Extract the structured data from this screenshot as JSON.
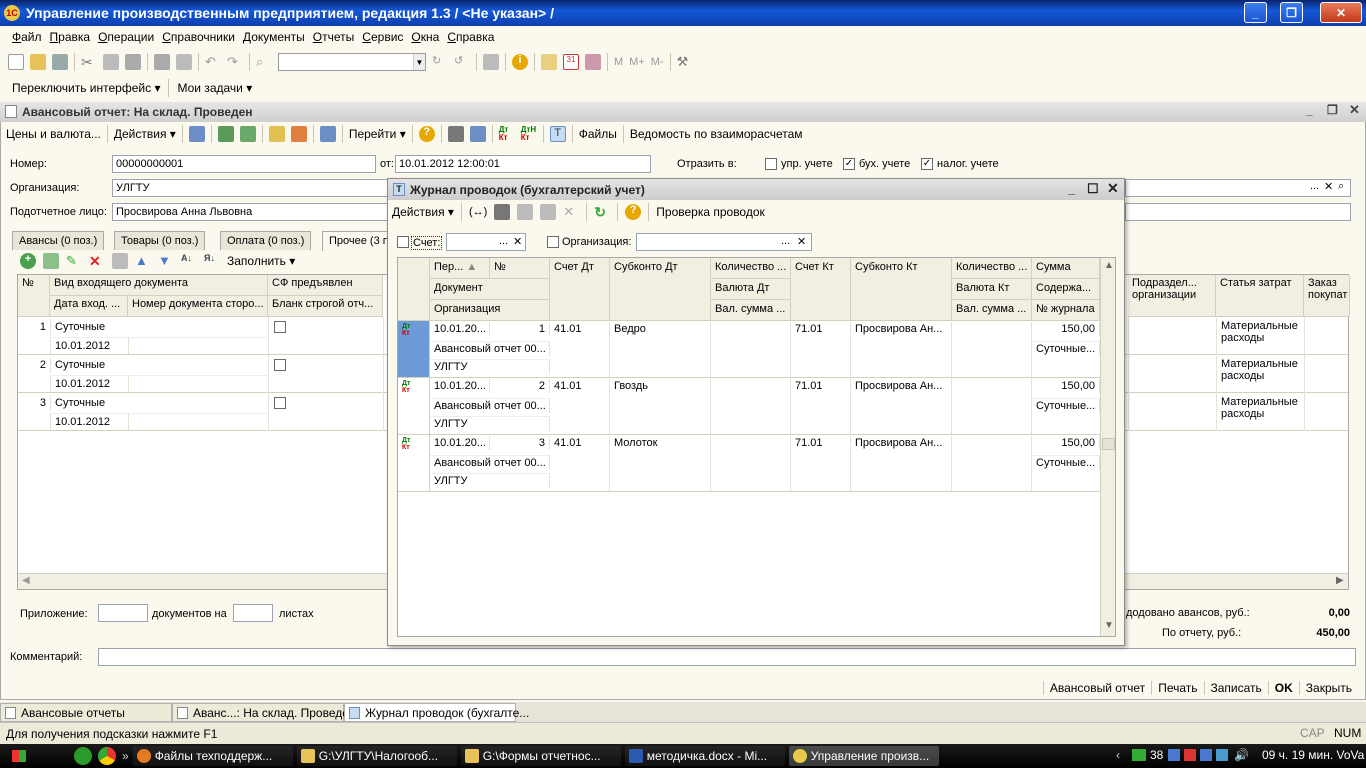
{
  "app": {
    "title": "Управление производственным предприятием, редакция 1.3 / <Не указан> /"
  },
  "menu": [
    "Файл",
    "Правка",
    "Операции",
    "Справочники",
    "Документы",
    "Отчеты",
    "Сервис",
    "Окна",
    "Справка"
  ],
  "toolbar2": {
    "switch_interface": "Переключить интерфейс",
    "my_tasks": "Мои задачи"
  },
  "doc": {
    "title": "Авансовый отчет: На склад. Проведен",
    "toolbar": {
      "prices": "Цены и валюта...",
      "actions": "Действия",
      "goto": "Перейти",
      "files": "Файлы",
      "statement": "Ведомость по взаиморасчетам"
    },
    "number_label": "Номер:",
    "number": "00000000001",
    "from_label": "от:",
    "date": "10.01.2012 12:00:01",
    "reflect_label": "Отразить в:",
    "reflect": [
      {
        "label": "упр. учете",
        "checked": false
      },
      {
        "label": "бух. учете",
        "checked": true
      },
      {
        "label": "налог. учете",
        "checked": true
      }
    ],
    "org_label": "Организация:",
    "org": "УЛГТУ",
    "person_label": "Подотчетное лицо:",
    "person": "Просвирова Анна Львовна",
    "tabs": [
      "Авансы (0 поз.)",
      "Товары (0 поз.)",
      "Оплата (0 поз.)",
      "Прочее (3 п"
    ],
    "fill_label": "Заполнить",
    "columns": {
      "num": "№",
      "doctype": "Вид входящего документа",
      "date_in": "Дата вход. ...",
      "doc_num": "Номер документа сторо...",
      "sf": "СФ предъявлен",
      "blank": "Бланк строгой отч...",
      "dept": "Подраздел... организации",
      "cost": "Статья затрат",
      "order": "Заказ покупат"
    },
    "rows": [
      {
        "n": "1",
        "type": "Суточные",
        "date": "10.01.2012",
        "cost": "Материальные расходы"
      },
      {
        "n": "2",
        "type": "Суточные",
        "date": "10.01.2012",
        "cost": "Материальные расходы"
      },
      {
        "n": "3",
        "type": "Суточные",
        "date": "10.01.2012",
        "cost": "Материальные расходы"
      }
    ],
    "attach_label": "Приложение:",
    "docs_on": "документов на",
    "sheets": "листах",
    "adv_label": "додовано авансов, руб.:",
    "adv_value": "0,00",
    "report_label": "По отчету, руб.:",
    "report_value": "450,00",
    "comment_label": "Комментарий:"
  },
  "bottom": [
    "Авансовый отчет",
    "Печать",
    "Записать",
    "OK",
    "Закрыть"
  ],
  "journal": {
    "title": "Журнал проводок (бухгалтерский учет)",
    "actions": "Действия",
    "check": "Проверка проводок",
    "filter_account": "Счет:",
    "filter_org": "Организация:",
    "headers": {
      "period": "Пер...",
      "num": "№",
      "acc_dt": "Счет Дт",
      "sub_dt": "Субконто Дт",
      "qty_dt": "Количество ...",
      "acc_kt": "Счет Кт",
      "sub_kt": "Субконто Кт",
      "qty_kt": "Количество ...",
      "sum": "Сумма",
      "document": "Документ",
      "cur_dt": "Валюта Дт",
      "cur_kt": "Валюта Кт",
      "content": "Содержа...",
      "organization": "Организация",
      "cur_sum_dt": "Вал. сумма ...",
      "cur_sum_kt": "Вал. сумма ...",
      "journal_no": "№ журнала"
    },
    "rows": [
      {
        "date": "10.01.20...",
        "n": "1",
        "acc_dt": "41.01",
        "sub_dt": "Ведро",
        "acc_kt": "71.01",
        "sub_kt": "Просвирова Ан...",
        "sum": "150,00",
        "doc": "Авансовый отчет 00...",
        "content": "Суточные...",
        "org": "УЛГТУ"
      },
      {
        "date": "10.01.20...",
        "n": "2",
        "acc_dt": "41.01",
        "sub_dt": "Гвоздь",
        "acc_kt": "71.01",
        "sub_kt": "Просвирова Ан...",
        "sum": "150,00",
        "doc": "Авансовый отчет 00...",
        "content": "Суточные...",
        "org": "УЛГТУ"
      },
      {
        "date": "10.01.20...",
        "n": "3",
        "acc_dt": "41.01",
        "sub_dt": "Молоток",
        "acc_kt": "71.01",
        "sub_kt": "Просвирова Ан...",
        "sum": "150,00",
        "doc": "Авансовый отчет 00...",
        "content": "Суточные...",
        "org": "УЛГТУ"
      }
    ],
    "row_icon": "Дт Кт"
  },
  "window_tabs": [
    "Авансовые отчеты",
    "Аванс...: На склад. Проведен",
    "Журнал проводок (бухгалте..."
  ],
  "status": {
    "hint": "Для получения подсказки нажмите F1",
    "cap": "CAP",
    "num": "NUM"
  },
  "taskbar": {
    "items": [
      "Файлы техподдерж...",
      "G:\\УЛГТУ\\Налогооб...",
      "G:\\Формы отчетнос...",
      "методичка.docx - Mi...",
      "Управление произв..."
    ],
    "tray_num": "38",
    "clock": "09 ч. 19 мин. VoVa"
  }
}
